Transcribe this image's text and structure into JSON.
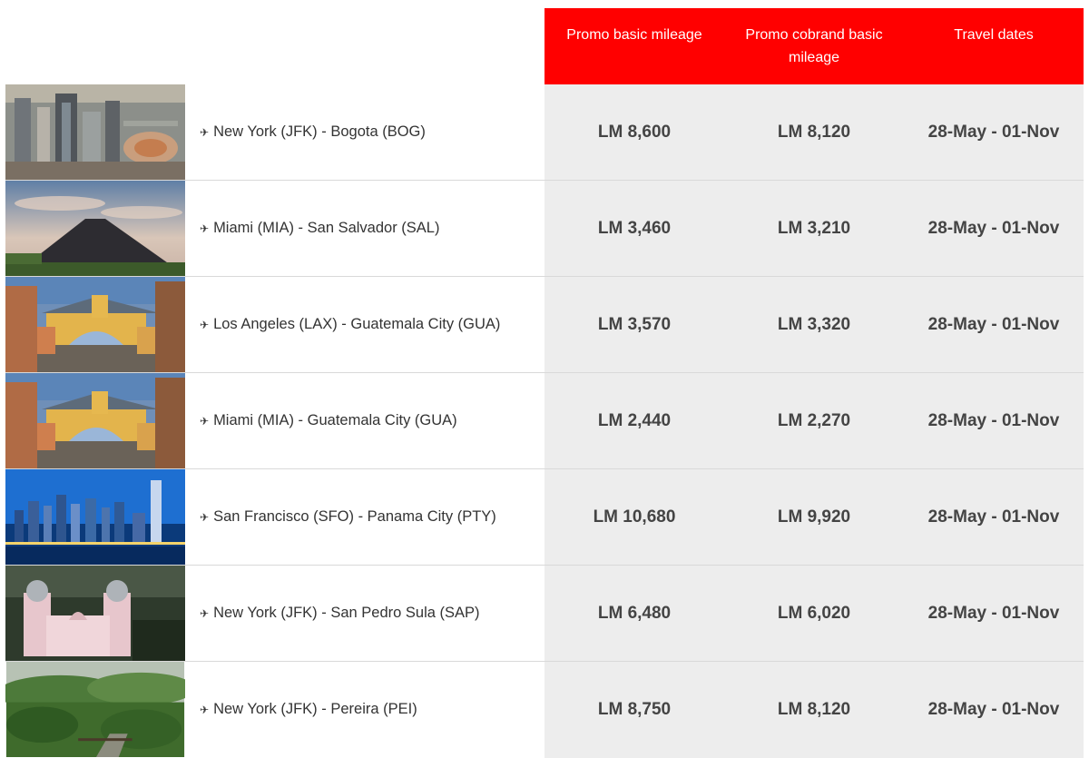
{
  "header": {
    "col1": "Promo basic mileage",
    "col2": "Promo cobrand basic mileage",
    "col3": "Travel dates"
  },
  "colors": {
    "header_bg": "#ff0000",
    "value_col_bg": "#ededed",
    "text": "#333333"
  },
  "rows": [
    {
      "route": "New York (JFK) - Bogota (BOG)",
      "basic": "LM 8,600",
      "cobrand": "LM 8,120",
      "dates": "28-May - 01-Nov",
      "image": "bogota-city-aerial-image"
    },
    {
      "route": "Miami (MIA) - San Salvador (SAL)",
      "basic": "LM 3,460",
      "cobrand": "LM 3,210",
      "dates": "28-May - 01-Nov",
      "image": "volcano-image"
    },
    {
      "route": "Los Angeles (LAX) - Guatemala City (GUA)",
      "basic": "LM 3,570",
      "cobrand": "LM 3,320",
      "dates": "28-May - 01-Nov",
      "image": "antigua-arch-image"
    },
    {
      "route": "Miami (MIA) - Guatemala City (GUA)",
      "basic": "LM 2,440",
      "cobrand": "LM 2,270",
      "dates": "28-May - 01-Nov",
      "image": "antigua-arch-image"
    },
    {
      "route": "San Francisco (SFO) - Panama City (PTY)",
      "basic": "LM 10,680",
      "cobrand": "LM 9,920",
      "dates": "28-May - 01-Nov",
      "image": "panama-skyline-image"
    },
    {
      "route": "New York (JFK) - San Pedro Sula (SAP)",
      "basic": "LM 6,480",
      "cobrand": "LM 6,020",
      "dates": "28-May - 01-Nov",
      "image": "cathedral-image"
    },
    {
      "route": "New York (JFK) - Pereira (PEI)",
      "basic": "LM 8,750",
      "cobrand": "LM 8,120",
      "dates": "28-May - 01-Nov",
      "image": "coffee-landscape-image"
    }
  ]
}
